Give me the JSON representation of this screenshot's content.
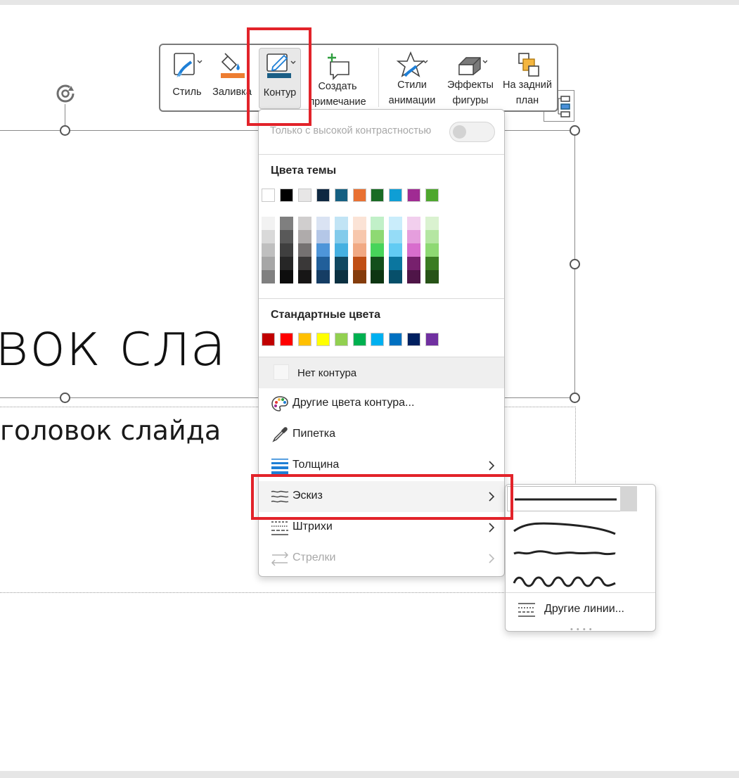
{
  "slide": {
    "title_text": "вок сла",
    "subtitle_text": "головок слайда"
  },
  "toolbar": {
    "buttons": [
      {
        "id": "style",
        "label": "Стиль"
      },
      {
        "id": "fill",
        "label": "Заливка",
        "bar_color": "#ed7d31"
      },
      {
        "id": "outline",
        "label": "Контур",
        "bar_color": "#1b5e85",
        "active": true
      },
      {
        "id": "comment",
        "label_line1": "Создать",
        "label_line2": "примечание"
      },
      {
        "id": "animation",
        "label_line1": "Стили",
        "label_line2": "анимации"
      },
      {
        "id": "effects",
        "label_line1": "Эффекты",
        "label_line2": "фигуры"
      },
      {
        "id": "back",
        "label_line1": "На задний",
        "label_line2": "план"
      }
    ]
  },
  "menu": {
    "high_contrast_label": "Только с высокой контрастностью",
    "theme_colors_title": "Цвета темы",
    "theme_colors": [
      "#ffffff",
      "#000000",
      "#e7e6e6",
      "#0e2841",
      "#156082",
      "#e97132",
      "#196b24",
      "#0f9ed5",
      "#a02b93",
      "#4ea72e"
    ],
    "theme_shades": [
      [
        "#f2f2f2",
        "#d9d9d9",
        "#bfbfbf",
        "#a6a6a6",
        "#808080"
      ],
      [
        "#7f7f7f",
        "#595959",
        "#3f3f3f",
        "#262626",
        "#0d0d0d"
      ],
      [
        "#d0cece",
        "#afabab",
        "#757171",
        "#3a3838",
        "#171616"
      ],
      [
        "#dae3f3",
        "#b4c7e7",
        "#4e95d9",
        "#215f9a",
        "#153d64"
      ],
      [
        "#c1e4f5",
        "#83cbeb",
        "#45b0e1",
        "#104861",
        "#0b3041"
      ],
      [
        "#fbe3d6",
        "#f7c7ac",
        "#f1a983",
        "#c04f15",
        "#843c0c"
      ],
      [
        "#c1f0c8",
        "#8ed973",
        "#47d45a",
        "#134f1b",
        "#0d3512"
      ],
      [
        "#caedfb",
        "#95dcf7",
        "#61cbf3",
        "#0b769f",
        "#074f6a"
      ],
      [
        "#f2cfee",
        "#e59edd",
        "#d86dcd",
        "#77206d",
        "#4f1548"
      ],
      [
        "#daf2d0",
        "#b5e6a2",
        "#8ed973",
        "#3a7c22",
        "#275317"
      ]
    ],
    "standard_colors_title": "Стандартные цвета",
    "standard_colors": [
      "#c00000",
      "#ff0000",
      "#ffc000",
      "#ffff00",
      "#92d050",
      "#00b050",
      "#00b0f0",
      "#0070c0",
      "#002060",
      "#7030a0"
    ],
    "no_outline_label": "Нет контура",
    "items": [
      {
        "id": "more-colors",
        "label": "Другие цвета контура...",
        "submenu": false,
        "disabled": false
      },
      {
        "id": "eyedropper",
        "label": "Пипетка",
        "submenu": false,
        "disabled": false
      },
      {
        "id": "weight",
        "label": "Толщина",
        "submenu": true,
        "disabled": false
      },
      {
        "id": "sketch",
        "label": "Эскиз",
        "submenu": true,
        "disabled": false,
        "hovered": true
      },
      {
        "id": "dashes",
        "label": "Штрихи",
        "submenu": true,
        "disabled": false
      },
      {
        "id": "arrows",
        "label": "Стрелки",
        "submenu": true,
        "disabled": true
      }
    ]
  },
  "sketch_submenu": {
    "options": [
      "none",
      "curved",
      "freehand",
      "scribble"
    ],
    "selected": "none",
    "more_label": "Другие линии..."
  },
  "colors": {
    "highlight": "#e2232a",
    "selection": "#8a8a8a"
  }
}
